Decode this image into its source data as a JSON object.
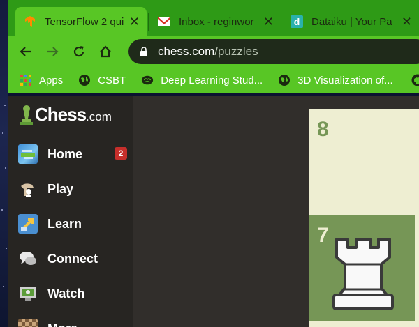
{
  "browser": {
    "tabs": [
      {
        "title": "TensorFlow 2 qui",
        "icon": "tensorflow-icon",
        "active": true
      },
      {
        "title": "Inbox - reginwor",
        "icon": "gmail-icon",
        "active": false
      },
      {
        "title": "Dataiku | Your Pa",
        "icon": "dataiku-icon",
        "active": false
      }
    ],
    "url_host": "chess.com",
    "url_path": "/puzzles",
    "bookmarks": [
      {
        "label": "Apps",
        "icon": "apps-grid-icon"
      },
      {
        "label": "CSBT",
        "icon": "globe-icon"
      },
      {
        "label": "Deep Learning Stud...",
        "icon": "brain-icon"
      },
      {
        "label": "3D Visualization of...",
        "icon": "globe-icon"
      }
    ]
  },
  "site": {
    "logo_main": "Chess",
    "logo_suffix": ".com",
    "nav": [
      {
        "label": "Home",
        "icon": "home-icon",
        "badge": "2"
      },
      {
        "label": "Play",
        "icon": "play-hand-icon"
      },
      {
        "label": "Learn",
        "icon": "learn-icon"
      },
      {
        "label": "Connect",
        "icon": "connect-chat-icon"
      },
      {
        "label": "Watch",
        "icon": "watch-tv-icon"
      },
      {
        "label": "More",
        "icon": "more-board-icon"
      }
    ]
  },
  "board": {
    "rank_labels": [
      "8",
      "7"
    ],
    "piece": "white-rook"
  },
  "colors": {
    "tab_strip": "#2e9a16",
    "toolbar": "#58c625",
    "sidebar": "#272522",
    "page_bg": "#312e2b",
    "light_square": "#eeeed2",
    "dark_square": "#769656"
  }
}
